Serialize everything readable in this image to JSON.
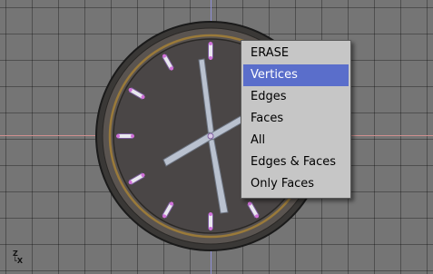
{
  "viewport": {
    "grid_color": "#757575",
    "x_axis_color": "#d09090",
    "y_axis_color": "#8f8fd6"
  },
  "mini_axes": {
    "z_label": "Z",
    "x_label": "└X"
  },
  "erase_menu": {
    "title": "ERASE",
    "items": [
      {
        "label": "Vertices",
        "highlighted": true
      },
      {
        "label": "Edges",
        "highlighted": false
      },
      {
        "label": "Faces",
        "highlighted": false
      },
      {
        "label": "All",
        "highlighted": false
      },
      {
        "label": "Edges & Faces",
        "highlighted": false
      },
      {
        "label": "Only Faces",
        "highlighted": false
      }
    ],
    "highlight_color": "#5a6ecb"
  },
  "clock_model": {
    "face_color": "#4a4646",
    "rim_color": "#5a5450",
    "ring_color": "#9a7a3a",
    "hand_color": "#b9c1cf",
    "marker_count": 12
  }
}
